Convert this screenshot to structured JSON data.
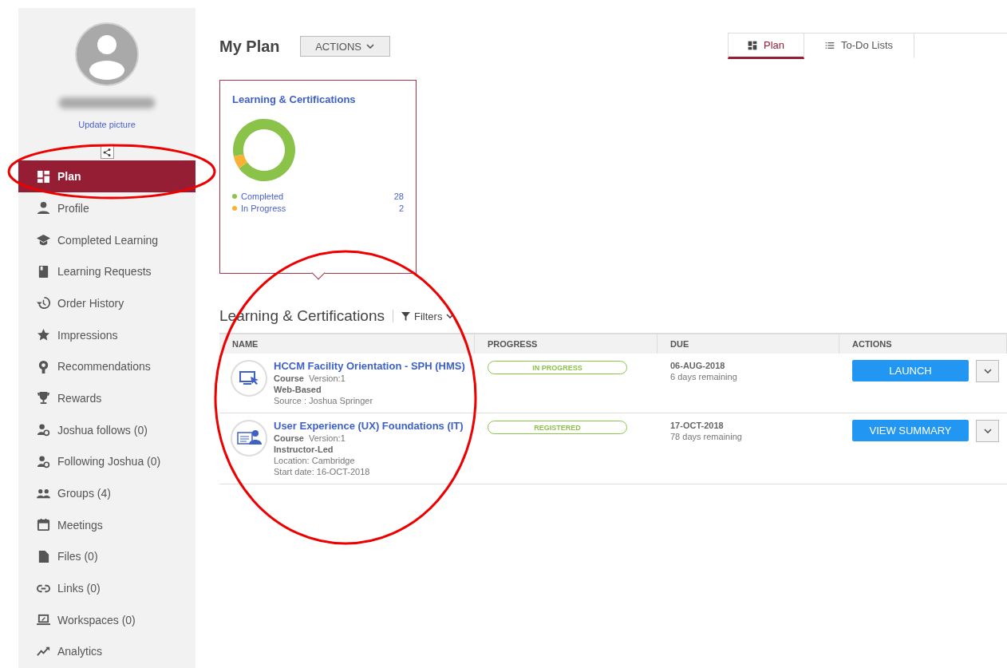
{
  "sidebar": {
    "update_picture": "Update picture",
    "items": [
      {
        "label": "Plan",
        "selected": true
      },
      {
        "label": "Profile",
        "selected": false
      },
      {
        "label": "Completed Learning",
        "selected": false
      },
      {
        "label": "Learning Requests",
        "selected": false
      },
      {
        "label": "Order History",
        "selected": false
      },
      {
        "label": "Impressions",
        "selected": false
      },
      {
        "label": "Recommendations",
        "selected": false
      },
      {
        "label": "Rewards",
        "selected": false
      },
      {
        "label": "Joshua follows (0)",
        "selected": false
      },
      {
        "label": "Following Joshua (0)",
        "selected": false
      },
      {
        "label": "Groups (4)",
        "selected": false
      },
      {
        "label": "Meetings",
        "selected": false
      },
      {
        "label": "Files (0)",
        "selected": false
      },
      {
        "label": "Links (0)",
        "selected": false
      },
      {
        "label": "Workspaces (0)",
        "selected": false
      },
      {
        "label": "Analytics",
        "selected": false
      }
    ]
  },
  "header": {
    "title": "My Plan",
    "actions_button": "ACTIONS"
  },
  "tabs": [
    {
      "label": "Plan",
      "selected": true
    },
    {
      "label": "To-Do Lists",
      "selected": false
    }
  ],
  "summary_card": {
    "title": "Learning & Certifications",
    "chart_data": {
      "type": "donut",
      "categories": [
        "Completed",
        "In Progress"
      ],
      "values": [
        28,
        2
      ],
      "value_labels": [
        "28",
        "2"
      ],
      "legend": "bottom",
      "colors": [
        "#8bc34a",
        "#f9b233"
      ]
    }
  },
  "section": {
    "title": "Learning & Certifications",
    "filters": "Filters"
  },
  "table": {
    "columns": [
      "NAME",
      "PROGRESS",
      "DUE",
      "ACTIONS"
    ],
    "rows": [
      {
        "kind": "web",
        "title": "HCCM Facility Orientation - SPH (HMS)",
        "type": "Course",
        "version": "Version:1",
        "delivery": "Web-Based",
        "details": [
          "Source : Joshua Springer"
        ],
        "progress": "IN PROGRESS",
        "due": "06-AUG-2018",
        "remaining": "6 days remaining",
        "action": "LAUNCH"
      },
      {
        "kind": "instructor",
        "title": "User Experience (UX) Foundations (IT)",
        "type": "Course",
        "version": "Version:1",
        "delivery": "Instructor-Led",
        "details": [
          "Location: Cambridge",
          "Start date: 16-OCT-2018"
        ],
        "progress": "REGISTERED",
        "due": "17-OCT-2018",
        "remaining": "78 days remaining",
        "action": "VIEW SUMMARY"
      }
    ]
  }
}
